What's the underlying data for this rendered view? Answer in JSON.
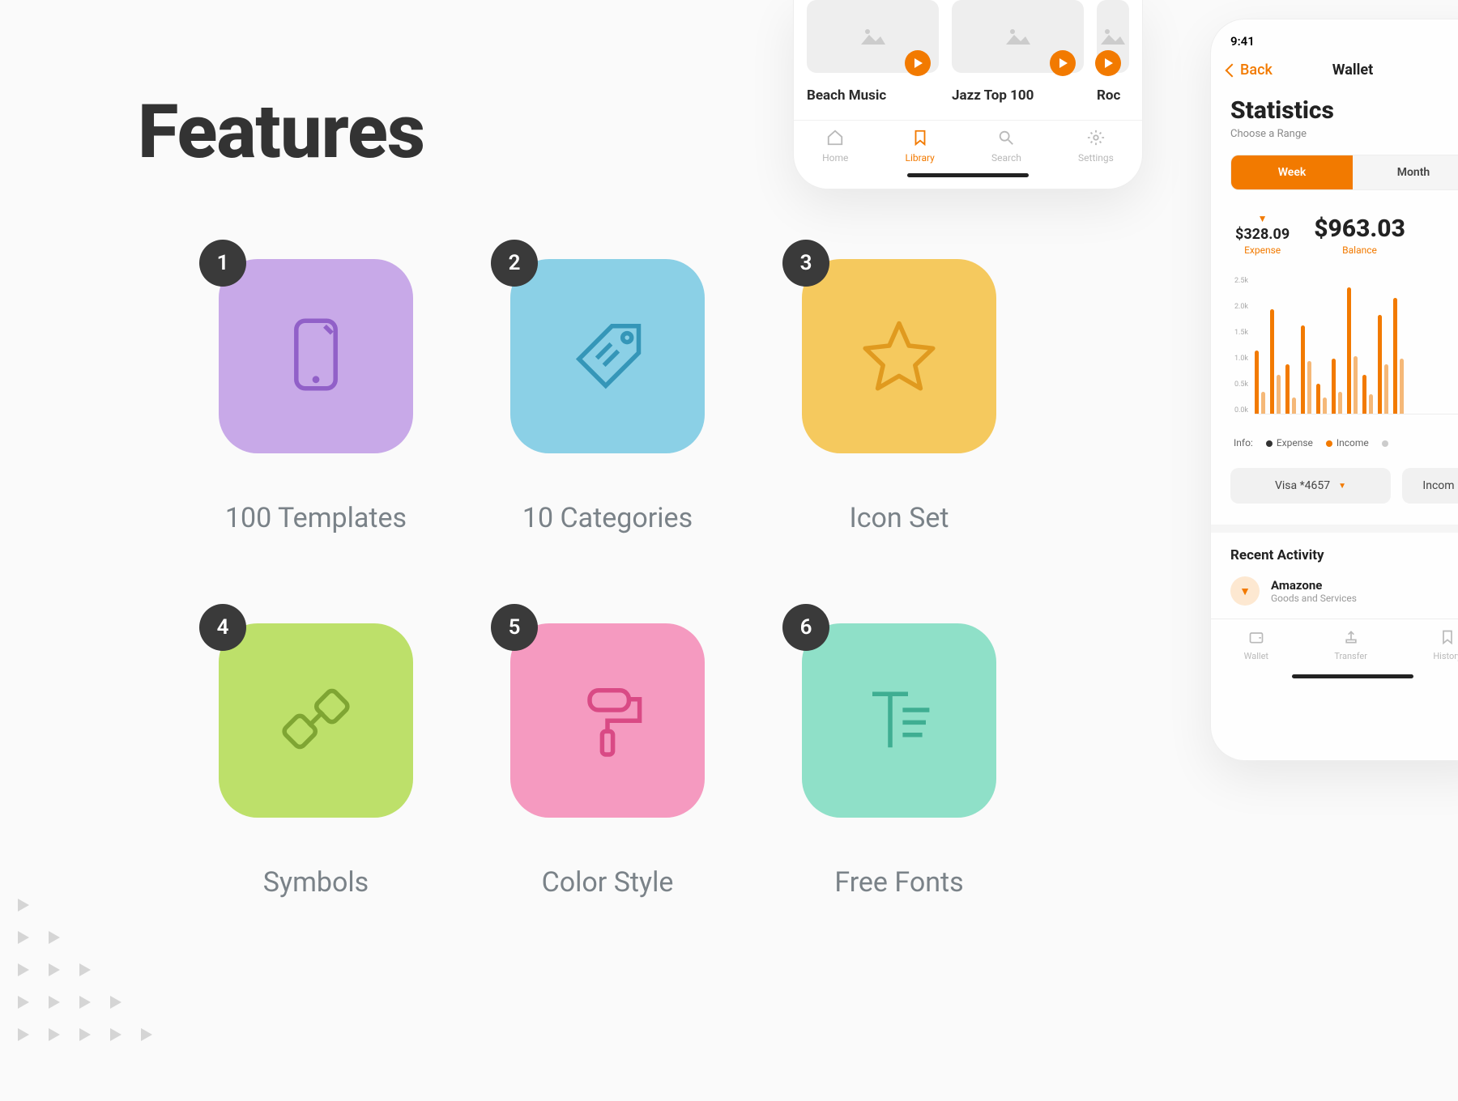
{
  "heading": "Features",
  "features": [
    {
      "num": "1",
      "label": "100 Templates",
      "color": "purple",
      "icon": "phone-icon"
    },
    {
      "num": "2",
      "label": "10 Categories",
      "color": "blue",
      "icon": "tag-icon"
    },
    {
      "num": "3",
      "label": "Icon Set",
      "color": "yellow",
      "icon": "star-icon"
    },
    {
      "num": "4",
      "label": "Symbols",
      "color": "green",
      "icon": "link-icon"
    },
    {
      "num": "5",
      "label": "Color Style",
      "color": "pink",
      "icon": "roller-icon"
    },
    {
      "num": "6",
      "label": "Free Fonts",
      "color": "teal",
      "icon": "text-icon"
    }
  ],
  "music": {
    "albums": [
      "Beach Music",
      "Jazz Top 100",
      "Roc"
    ],
    "tabs": [
      "Home",
      "Library",
      "Search",
      "Settings"
    ],
    "active_tab": "Library"
  },
  "wallet": {
    "time": "9:41",
    "back": "Back",
    "nav_title": "Wallet",
    "title": "Statistics",
    "subtitle": "Choose a Range",
    "segments": [
      "Week",
      "Month"
    ],
    "active_segment": "Week",
    "expense": {
      "value": "$328.09",
      "label": "Expense"
    },
    "balance": {
      "value": "$963.03",
      "label": "Balance"
    },
    "legend_label": "Info:",
    "legend": [
      "Expense",
      "Income"
    ],
    "select_card": "Visa *4657",
    "select_type": "Incom",
    "recent_heading": "Recent Activity",
    "activity": {
      "name": "Amazone",
      "sub": "Goods and Services"
    },
    "tabs": [
      "Wallet",
      "Transfer",
      "History"
    ]
  },
  "chart_data": {
    "type": "bar",
    "ylabel": "",
    "yticks": [
      "2.5k",
      "2.0k",
      "1.5k",
      "1.0k",
      "0.5k",
      "0.0k"
    ],
    "ylim": [
      0,
      2.5
    ],
    "series": [
      {
        "name": "Expense",
        "values": [
          1.15,
          1.9,
          0.9,
          1.6,
          0.55,
          1.0,
          2.3,
          0.7,
          1.8,
          2.1
        ]
      },
      {
        "name": "Income",
        "values": [
          0.4,
          0.7,
          0.3,
          0.95,
          0.3,
          0.4,
          1.05,
          0.35,
          0.9,
          1.0
        ]
      }
    ]
  }
}
